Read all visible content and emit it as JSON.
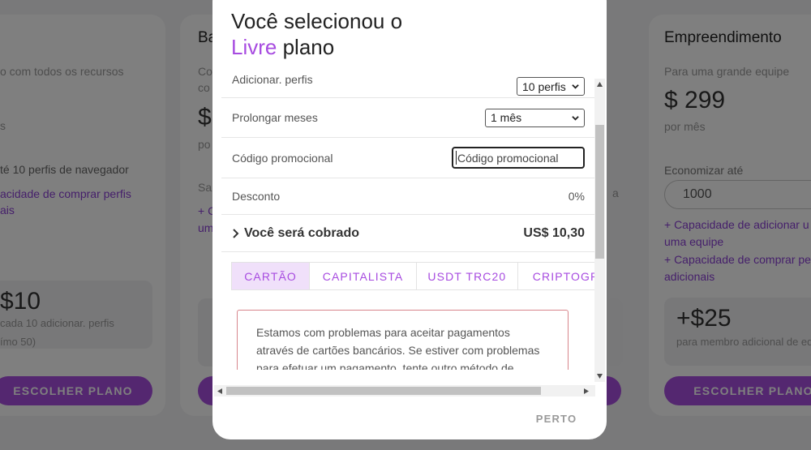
{
  "background": {
    "left_card": {
      "desc": "o com todos os recursos",
      "desc2": "s",
      "feature1": "té 10 perfis de navegador",
      "link1": "acidade de comprar perfis",
      "link2": "ais",
      "price": "$10",
      "note1": "cada 10 adicionar. perfis",
      "note2": "ímo 50)",
      "button": "ESCOLHER PLANO"
    },
    "mid_card": {
      "title": "Ba",
      "desc1": "Co",
      "desc2": "co",
      "price": "$",
      "period": "po",
      "save": "Sa",
      "feat": "+ C",
      "feat2": "um"
    },
    "right_card": {
      "title": "Empreendimento",
      "desc": "Para uma grande equipe",
      "price": "$ 299",
      "period": "por mês",
      "save_label": "Economizar até",
      "save_value": "1000",
      "link1": "+ Capacidade de adicionar u",
      "link1b": "uma equipe",
      "link2": "+ Capacidade de comprar perf",
      "link2b": "adicionais",
      "addon_price": "+$25",
      "addon_note": "para membro adicional de eq",
      "button": "ESCOLHER PLANO"
    },
    "mid_right_edge": "a"
  },
  "modal": {
    "title_part1": "Você selecionou o",
    "title_accent": "Livre",
    "title_part2": "plano",
    "rows": {
      "profiles_label": "Adicionar. perfis",
      "profiles_value": "10 perfis",
      "months_label": "Prolongar meses",
      "months_value": "1 mês",
      "promo_label": "Código promocional",
      "promo_placeholder": "Código promocional",
      "discount_label": "Desconto",
      "discount_value": "0%"
    },
    "charge_label": "Você será cobrado",
    "charge_amount": "US$ 10,30",
    "tabs": [
      "CARTÃO",
      "CAPITALISTA",
      "USDT TRC20",
      "CRIPTOGR"
    ],
    "alert_text": "Estamos com problemas para aceitar pagamentos através de cartões bancários. Se estiver com problemas para efetuar um pagamento, tente outro método de pagamento",
    "close_label": "PERTO"
  },
  "colors": {
    "accent": "#a74be0",
    "alert_border": "#d8868c"
  }
}
